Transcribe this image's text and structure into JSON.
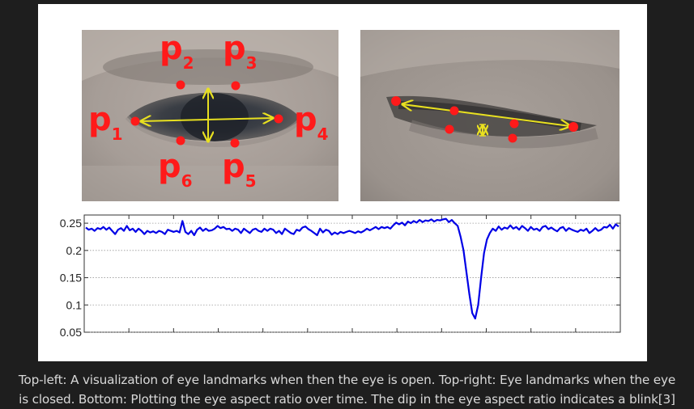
{
  "colors": {
    "landmark": "#ff1a1a",
    "guide": "#e8e020",
    "series": "#0000e6",
    "page_bg": "#1e1e1e",
    "caption_text": "#d8d8d8"
  },
  "open_eye": {
    "landmarks": [
      {
        "id": "p1",
        "letter": "p",
        "sub": "1"
      },
      {
        "id": "p2",
        "letter": "p",
        "sub": "2"
      },
      {
        "id": "p3",
        "letter": "p",
        "sub": "3"
      },
      {
        "id": "p4",
        "letter": "p",
        "sub": "4"
      },
      {
        "id": "p5",
        "letter": "p",
        "sub": "5"
      },
      {
        "id": "p6",
        "letter": "p",
        "sub": "6"
      }
    ]
  },
  "chart_data": {
    "type": "line",
    "ylim": [
      0.05,
      0.265
    ],
    "yticks": [
      "0.25",
      "0.2",
      "0.15",
      "0.1",
      "0.05"
    ],
    "ytick_values": [
      0.25,
      0.2,
      0.15,
      0.1,
      0.05
    ],
    "grid": true,
    "series": [
      {
        "values": [
          0.242,
          0.238,
          0.24,
          0.236,
          0.241,
          0.239,
          0.243,
          0.238,
          0.242,
          0.236,
          0.23,
          0.238,
          0.241,
          0.236,
          0.245,
          0.237,
          0.24,
          0.234,
          0.24,
          0.236,
          0.23,
          0.236,
          0.233,
          0.235,
          0.232,
          0.236,
          0.234,
          0.23,
          0.238,
          0.236,
          0.234,
          0.236,
          0.233,
          0.254,
          0.234,
          0.23,
          0.236,
          0.228,
          0.238,
          0.242,
          0.236,
          0.24,
          0.236,
          0.237,
          0.24,
          0.245,
          0.241,
          0.243,
          0.239,
          0.24,
          0.236,
          0.24,
          0.238,
          0.232,
          0.24,
          0.236,
          0.232,
          0.238,
          0.24,
          0.236,
          0.234,
          0.24,
          0.236,
          0.24,
          0.238,
          0.232,
          0.236,
          0.23,
          0.24,
          0.236,
          0.232,
          0.23,
          0.238,
          0.236,
          0.242,
          0.244,
          0.239,
          0.236,
          0.232,
          0.228,
          0.24,
          0.233,
          0.238,
          0.236,
          0.229,
          0.233,
          0.23,
          0.234,
          0.232,
          0.234,
          0.236,
          0.234,
          0.232,
          0.235,
          0.233,
          0.236,
          0.24,
          0.237,
          0.24,
          0.243,
          0.239,
          0.243,
          0.241,
          0.243,
          0.24,
          0.246,
          0.251,
          0.248,
          0.251,
          0.246,
          0.253,
          0.25,
          0.254,
          0.251,
          0.256,
          0.252,
          0.255,
          0.254,
          0.257,
          0.253,
          0.256,
          0.255,
          0.257,
          0.258,
          0.252,
          0.256,
          0.25,
          0.245,
          0.225,
          0.2,
          0.16,
          0.12,
          0.085,
          0.075,
          0.1,
          0.15,
          0.195,
          0.22,
          0.232,
          0.24,
          0.236,
          0.244,
          0.238,
          0.242,
          0.24,
          0.246,
          0.24,
          0.243,
          0.238,
          0.245,
          0.241,
          0.236,
          0.243,
          0.238,
          0.24,
          0.236,
          0.243,
          0.245,
          0.239,
          0.242,
          0.238,
          0.235,
          0.241,
          0.243,
          0.236,
          0.241,
          0.238,
          0.236,
          0.234,
          0.238,
          0.236,
          0.24,
          0.232,
          0.236,
          0.241,
          0.236,
          0.238,
          0.243,
          0.242,
          0.247,
          0.24,
          0.248,
          0.244
        ]
      }
    ]
  },
  "caption": {
    "line1": "Top-left: A visualization of eye landmarks when then the eye is open. Top-right: Eye landmarks when the eye",
    "line2": "is closed. Bottom: Plotting the eye aspect ratio over time. The dip in the eye aspect ratio indicates a blink[3]"
  }
}
